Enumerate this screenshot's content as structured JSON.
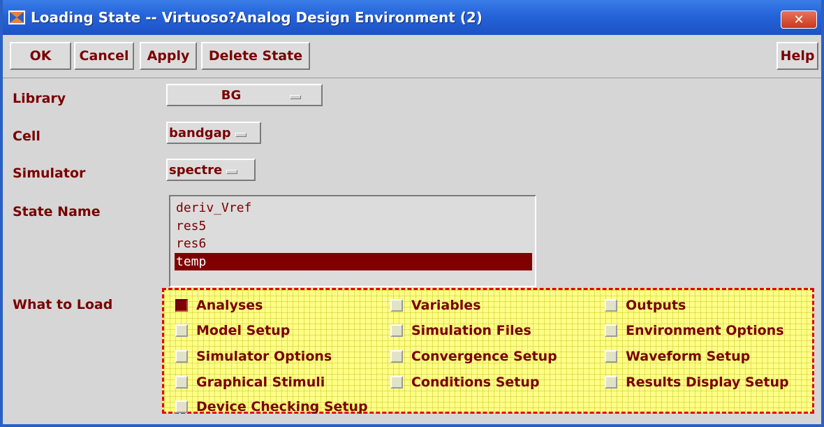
{
  "window": {
    "title": "Loading State -- Virtuoso?Analog Design Environment (2)",
    "close_label": "✕"
  },
  "toolbar": {
    "ok_label": "OK",
    "cancel_label": "Cancel",
    "apply_label": "Apply",
    "delete_state_label": "Delete State",
    "help_label": "Help"
  },
  "form": {
    "library": {
      "label": "Library",
      "value": "BG"
    },
    "cell": {
      "label": "Cell",
      "value": "bandgap"
    },
    "simulator": {
      "label": "Simulator",
      "value": "spectre"
    },
    "state_name": {
      "label": "State Name",
      "items": [
        "deriv_Vref",
        "res5",
        "res6",
        "temp"
      ],
      "selected": "temp"
    },
    "what_to_load": {
      "label": "What to Load",
      "options": [
        {
          "label": "Analyses",
          "checked": true
        },
        {
          "label": "Variables",
          "checked": false
        },
        {
          "label": "Outputs",
          "checked": false
        },
        {
          "label": "Model Setup",
          "checked": false
        },
        {
          "label": "Simulation Files",
          "checked": false
        },
        {
          "label": "Environment Options",
          "checked": false
        },
        {
          "label": "Simulator Options",
          "checked": false
        },
        {
          "label": "Convergence Setup",
          "checked": false
        },
        {
          "label": "Waveform Setup",
          "checked": false
        },
        {
          "label": "Graphical Stimuli",
          "checked": false
        },
        {
          "label": "Conditions Setup",
          "checked": false
        },
        {
          "label": "Results Display Setup",
          "checked": false
        },
        {
          "label": "Device Checking Setup",
          "checked": false
        }
      ]
    }
  },
  "colors": {
    "label_text": "#7a0000",
    "selection": "#800000",
    "highlight_fill": "#ffff88",
    "highlight_border": "#e0001c",
    "titlebar": "#2563d9"
  },
  "icons": {
    "app": "cadence-logo-icon",
    "close": "close-icon",
    "dropdown": "option-menu-indicator-icon"
  }
}
